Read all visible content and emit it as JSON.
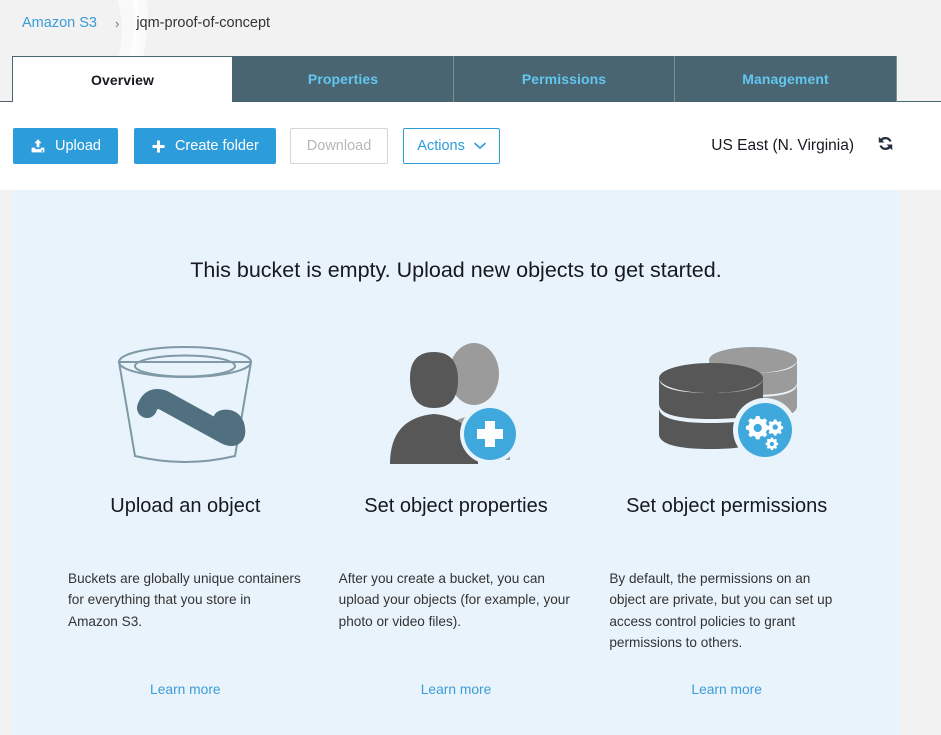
{
  "breadcrumb": {
    "root": "Amazon S3",
    "separator": "›",
    "current": "jqm-proof-of-concept"
  },
  "tabs": [
    {
      "label": "Overview",
      "active": true
    },
    {
      "label": "Properties",
      "active": false
    },
    {
      "label": "Permissions",
      "active": false
    },
    {
      "label": "Management",
      "active": false
    }
  ],
  "toolbar": {
    "upload_label": "Upload",
    "create_folder_label": "Create folder",
    "download_label": "Download",
    "actions_label": "Actions",
    "region_label": "US East (N. Virginia)",
    "refresh_icon": "refresh-icon",
    "upload_icon": "upload-icon",
    "plus_icon": "plus-icon",
    "chevron_icon": "chevron-down-icon"
  },
  "empty_state": {
    "title": "This bucket is empty. Upload new objects to get started.",
    "cards": [
      {
        "icon": "bucket-icon",
        "title": "Upload an object",
        "body": "Buckets are globally unique containers for everything that you store in Amazon S3.",
        "link": "Learn more"
      },
      {
        "icon": "users-add-icon",
        "title": "Set object properties",
        "body": "After you create a bucket, you can upload your objects (for example, your photo or video files).",
        "link": "Learn more"
      },
      {
        "icon": "database-gears-icon",
        "title": "Set object permissions",
        "body": "By default, the permissions on an object are private, but you can set up access control policies to grant permissions to others.",
        "link": "Learn more"
      }
    ]
  },
  "colors": {
    "accent_blue": "#2d9cdb",
    "link_blue": "#3b9cd9",
    "tab_inactive_bg": "#4a6572",
    "tab_inactive_text": "#62c6ef",
    "panel_bg": "#e9f3fb",
    "icon_dark": "#575757",
    "icon_light": "#9b9b9b",
    "badge_blue": "#3fa9dd"
  }
}
